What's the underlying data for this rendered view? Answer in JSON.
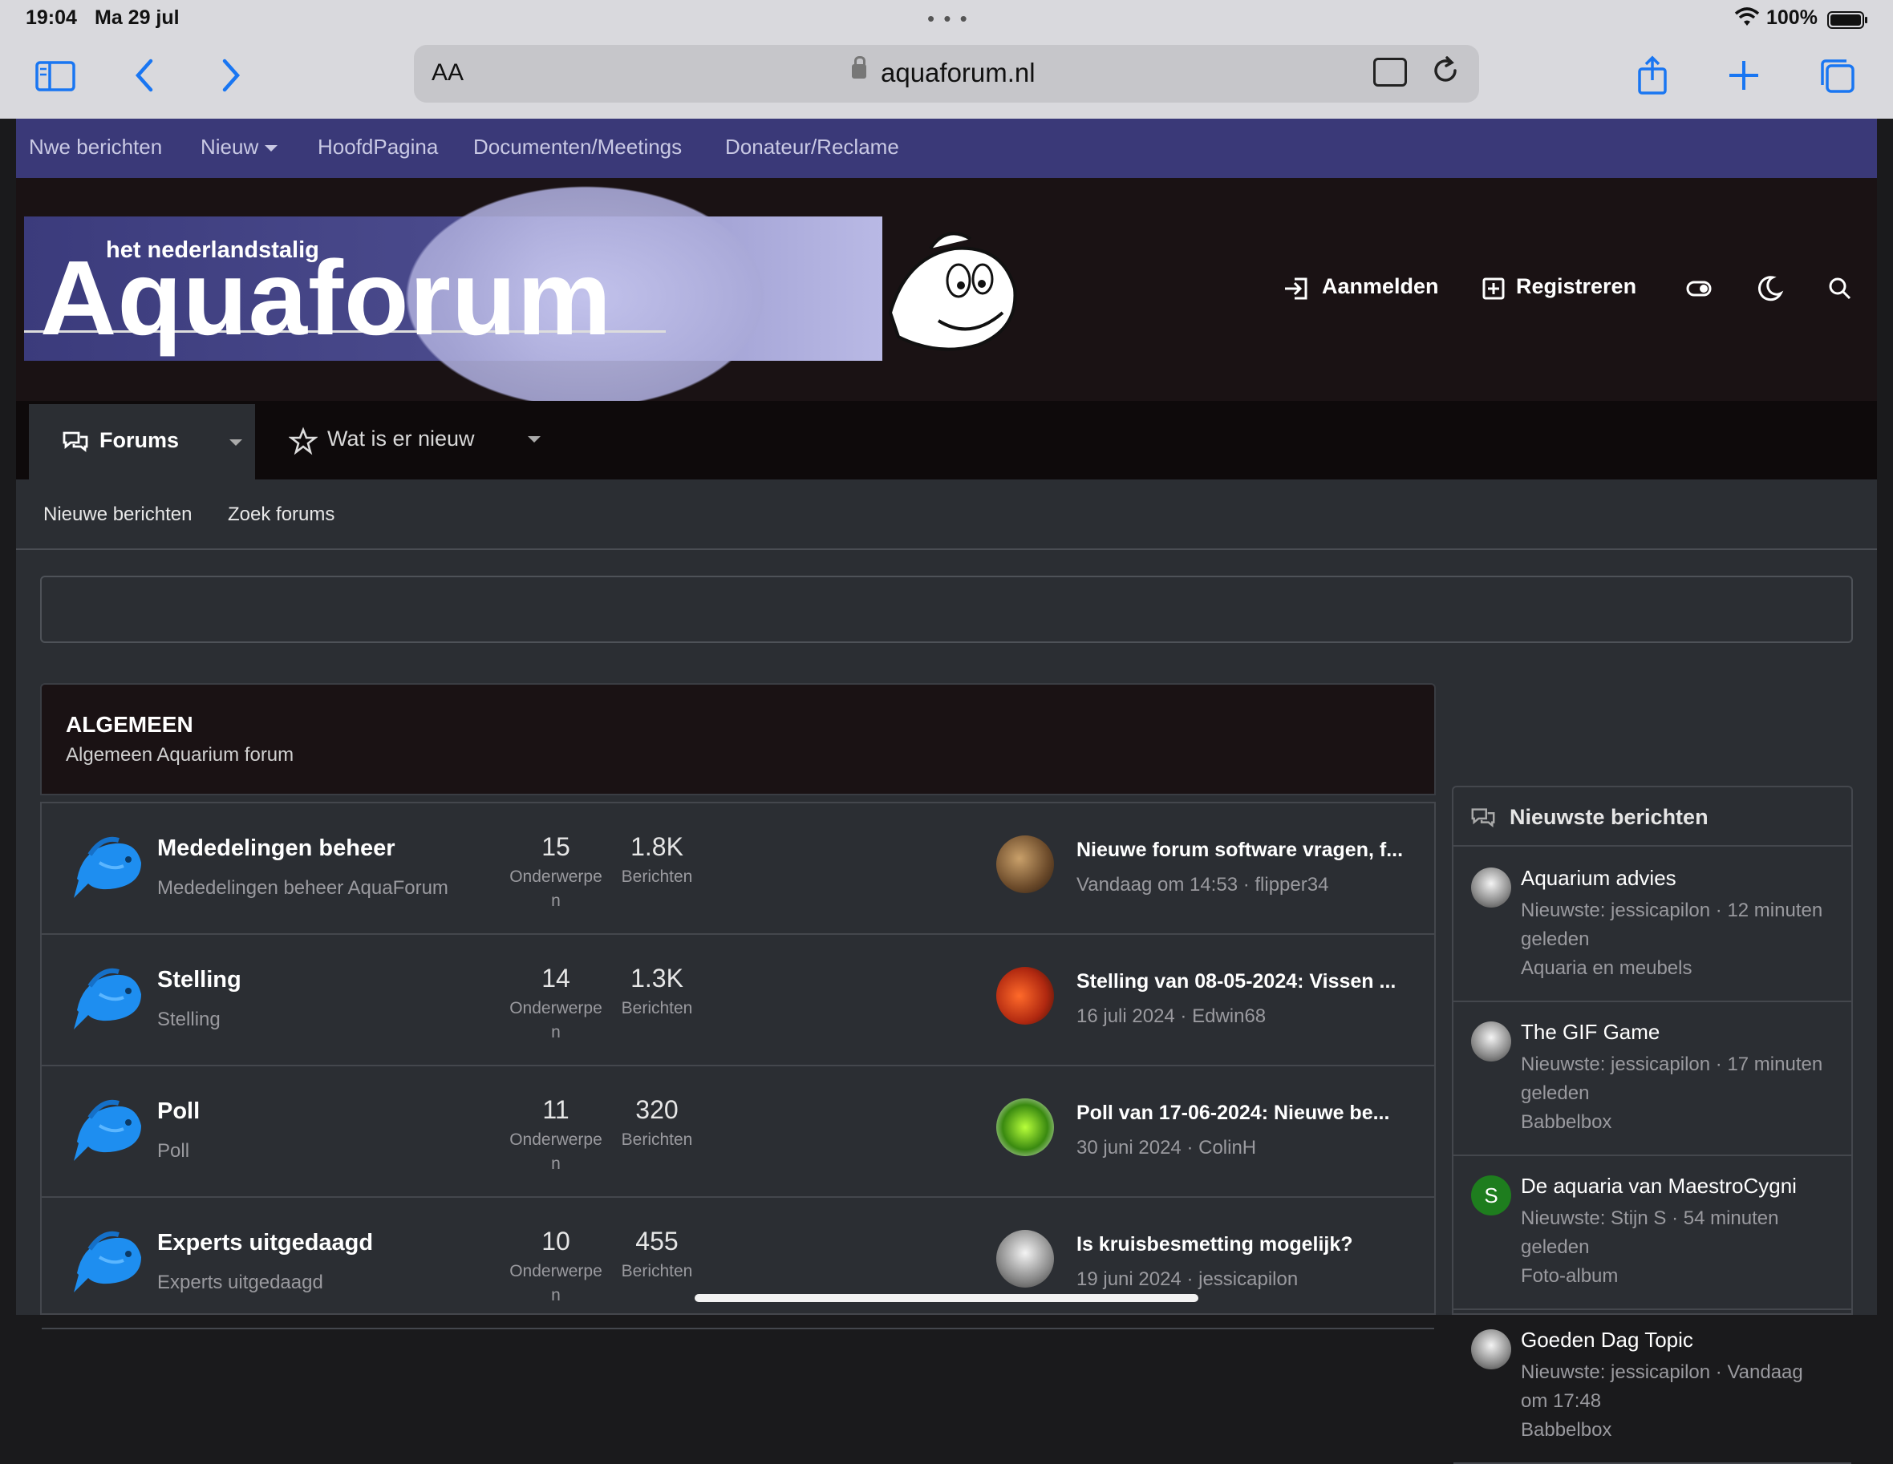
{
  "status": {
    "time": "19:04",
    "date": "Ma 29 jul",
    "battery": "100%"
  },
  "browser": {
    "aa_label": "AA",
    "url": "aquaforum.nl"
  },
  "topnav": [
    "Nwe berichten",
    "Nieuw",
    "HoofdPagina",
    "Documenten/Meetings",
    "Donateur/Reclame"
  ],
  "banner": {
    "subtitle": "het nederlandstalig",
    "title": "Aquaforum"
  },
  "header": {
    "login": "Aanmelden",
    "register": "Registreren"
  },
  "tabs": {
    "forums": "Forums",
    "whats_new": "Wat is er nieuw"
  },
  "subnav": {
    "new_posts": "Nieuwe berichten",
    "search": "Zoek forums"
  },
  "category": {
    "title": "ALGEMEEN",
    "description": "Algemeen Aquarium forum"
  },
  "forums": [
    {
      "name": "Mededelingen beheer",
      "desc": "Mededelingen beheer AquaForum",
      "threads": "15",
      "threads_label": "Onderwerpe n",
      "posts": "1.8K",
      "posts_label": "Berichten",
      "last_title": "Nieuwe forum software vragen, f...",
      "last_meta": "Vandaag om 14:53 · flipper34"
    },
    {
      "name": "Stelling",
      "desc": "Stelling",
      "threads": "14",
      "threads_label": "Onderwerpe n",
      "posts": "1.3K",
      "posts_label": "Berichten",
      "last_title": "Stelling van 08-05-2024: Vissen ...",
      "last_meta": "16 juli 2024 · Edwin68"
    },
    {
      "name": "Poll",
      "desc": "Poll",
      "threads": "11",
      "threads_label": "Onderwerpe n",
      "posts": "320",
      "posts_label": "Berichten",
      "last_title": "Poll van 17-06-2024: Nieuwe be...",
      "last_meta": "30 juni 2024 · ColinH"
    },
    {
      "name": "Experts uitgedaagd",
      "desc": "Experts uitgedaagd",
      "threads": "10",
      "threads_label": "Onderwerpe n",
      "posts": "455",
      "posts_label": "Berichten",
      "last_title": "Is kruisbesmetting mogelijk?",
      "last_meta": "19 juni 2024 · jessicapilon"
    }
  ],
  "sidebar": {
    "title": "Nieuwste berichten",
    "items": [
      {
        "title": "Aquarium advies",
        "meta": "Nieuwste: jessicapilon · 12 minuten geleden",
        "forum": "Aquaria en meubels",
        "avatar": "dog"
      },
      {
        "title": "The GIF Game",
        "meta": "Nieuwste: jessicapilon · 17 minuten geleden",
        "forum": "Babbelbox",
        "avatar": "dog"
      },
      {
        "title": "De aquaria van MaestroCygni",
        "meta": "Nieuwste: Stijn S · 54 minuten geleden",
        "forum": "Foto-album",
        "avatar": "S"
      },
      {
        "title": "Goeden Dag Topic",
        "meta": "Nieuwste: jessicapilon · Vandaag om 17:48",
        "forum": "Babbelbox",
        "avatar": "dog"
      }
    ]
  },
  "colors": {
    "topnav": "#3a3978",
    "accent_avatar_s": "#1e7d1e"
  }
}
